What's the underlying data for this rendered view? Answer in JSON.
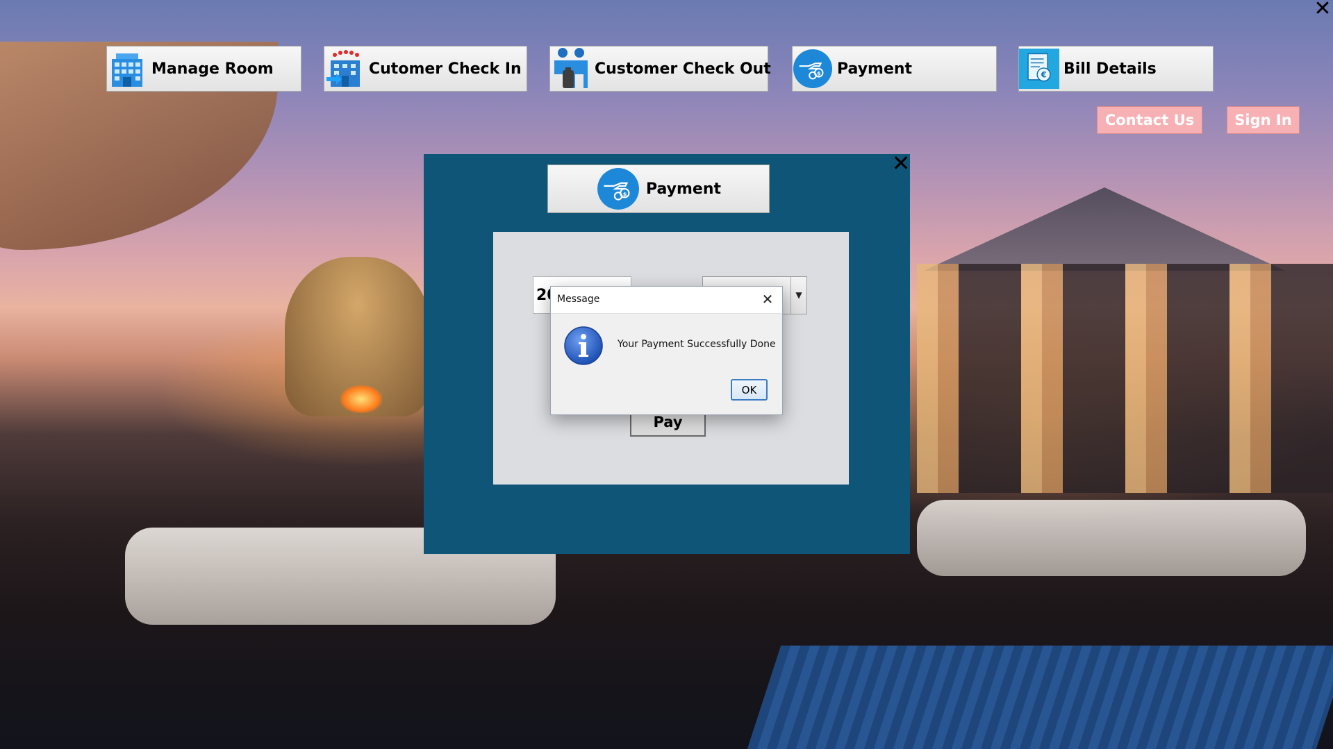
{
  "window": {
    "close_glyph": "✕"
  },
  "nav": [
    {
      "label": "Manage Room",
      "icon": "hotel-building-icon"
    },
    {
      "label": "Cutomer Check In",
      "icon": "check-in-building-icon"
    },
    {
      "label": "Customer Check Out",
      "icon": "check-out-people-icon"
    },
    {
      "label": "Payment",
      "icon": "payment-hand-icon"
    },
    {
      "label": "Bill Details",
      "icon": "bill-document-icon"
    }
  ],
  "links": {
    "contact_us": "Contact Us",
    "sign_in": "Sign In"
  },
  "payment_panel": {
    "title": "Payment",
    "close_glyph": "✕",
    "amount_value": "20",
    "combo_arrow": "▼",
    "pay_label": "Pay"
  },
  "dialog": {
    "title": "Message",
    "message": "Your Payment Successfully Done",
    "ok_label": "OK",
    "close_glyph": "✕"
  },
  "colors": {
    "panel_bg": "#0f5577",
    "form_bg": "#dcdde1",
    "link_bg": "#f7b1b5",
    "icon_blue": "#1e88d8"
  }
}
